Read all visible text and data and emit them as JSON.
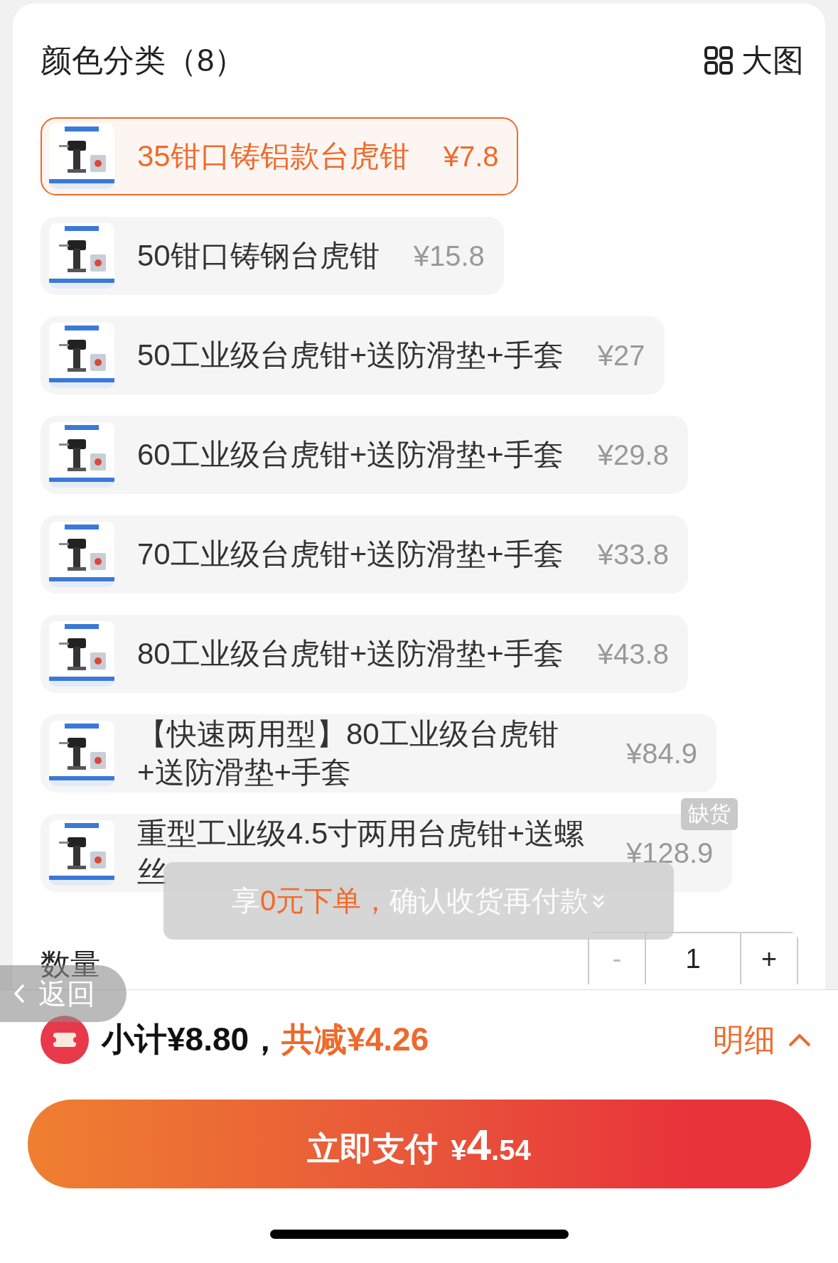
{
  "header": {
    "title": "颜色分类（8）",
    "view_toggle": "大图"
  },
  "variants": [
    {
      "name": "35钳口铸铝款台虎钳",
      "price": "¥7.8",
      "selected": true
    },
    {
      "name": "50钳口铸钢台虎钳",
      "price": "¥15.8",
      "selected": false
    },
    {
      "name": "50工业级台虎钳+送防滑垫+手套",
      "price": "¥27",
      "selected": false
    },
    {
      "name": "60工业级台虎钳+送防滑垫+手套",
      "price": "¥29.8",
      "selected": false
    },
    {
      "name": "70工业级台虎钳+送防滑垫+手套",
      "price": "¥33.8",
      "selected": false
    },
    {
      "name": "80工业级台虎钳+送防滑垫+手套",
      "price": "¥43.8",
      "selected": false
    },
    {
      "name": "【快速两用型】80工业级台虎钳+送防滑垫+手套",
      "price": "¥84.9",
      "selected": false
    },
    {
      "name": "重型工业级4.5寸两用台虎钳+送螺丝",
      "price": "¥128.9",
      "selected": false,
      "badge": "缺货"
    }
  ],
  "toast": {
    "prefix": "享",
    "highlight": "0元下单，",
    "suffix": "确认收货再付款"
  },
  "quantity": {
    "label": "数量",
    "decrease": "-",
    "value": "1",
    "increase": "+",
    "decrease_disabled": true
  },
  "back_button": {
    "label": "返回"
  },
  "summary": {
    "subtotal": "小计¥8.80，",
    "discount": "共减¥4.26",
    "details": "明细"
  },
  "pay_button": {
    "label": "立即支付",
    "currency": "¥",
    "integer": "4",
    "decimal": ".54"
  }
}
